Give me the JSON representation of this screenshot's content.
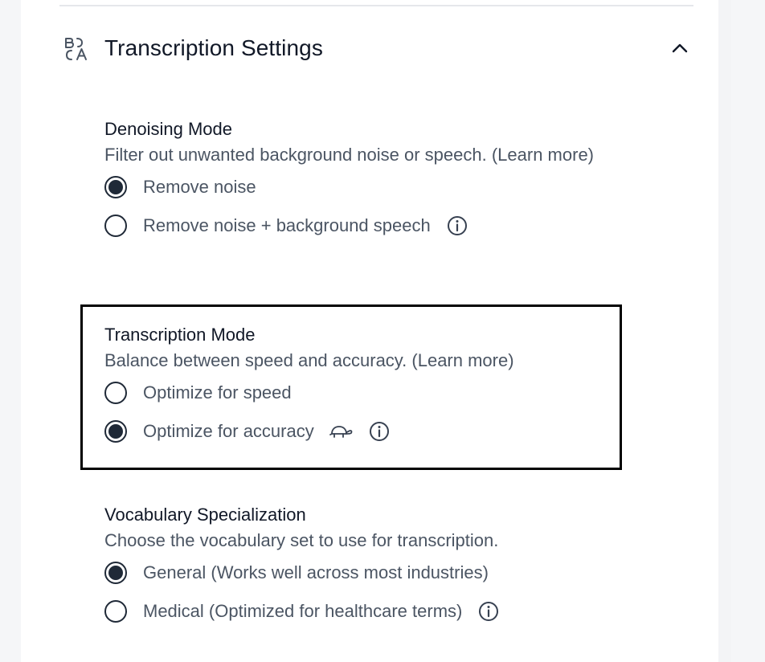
{
  "section": {
    "title": "Transcription Settings",
    "icon": "translate-icon",
    "collapse_icon": "chevron-up-icon"
  },
  "denoising": {
    "title": "Denoising Mode",
    "description": "Filter out unwanted background noise or speech. (Learn more)",
    "options": [
      {
        "label": "Remove noise",
        "selected": true
      },
      {
        "label": "Remove noise + background speech",
        "selected": false,
        "icon": "info-icon"
      }
    ]
  },
  "transcription": {
    "title": "Transcription Mode",
    "description": "Balance between speed and accuracy. (Learn more)",
    "options": [
      {
        "label": "Optimize for speed",
        "selected": false
      },
      {
        "label": "Optimize for accuracy",
        "selected": true,
        "icons": [
          "turtle-icon",
          "info-icon"
        ]
      }
    ]
  },
  "vocabulary": {
    "title": "Vocabulary Specialization",
    "description": "Choose the vocabulary set to use for transcription.",
    "options": [
      {
        "label": "General (Works well across most industries)",
        "selected": true
      },
      {
        "label": "Medical (Optimized for healthcare terms)",
        "selected": false,
        "icon": "info-icon"
      }
    ]
  },
  "colors": {
    "text_primary": "#111827",
    "text_secondary": "#4b5563",
    "highlight_border": "#000000"
  }
}
